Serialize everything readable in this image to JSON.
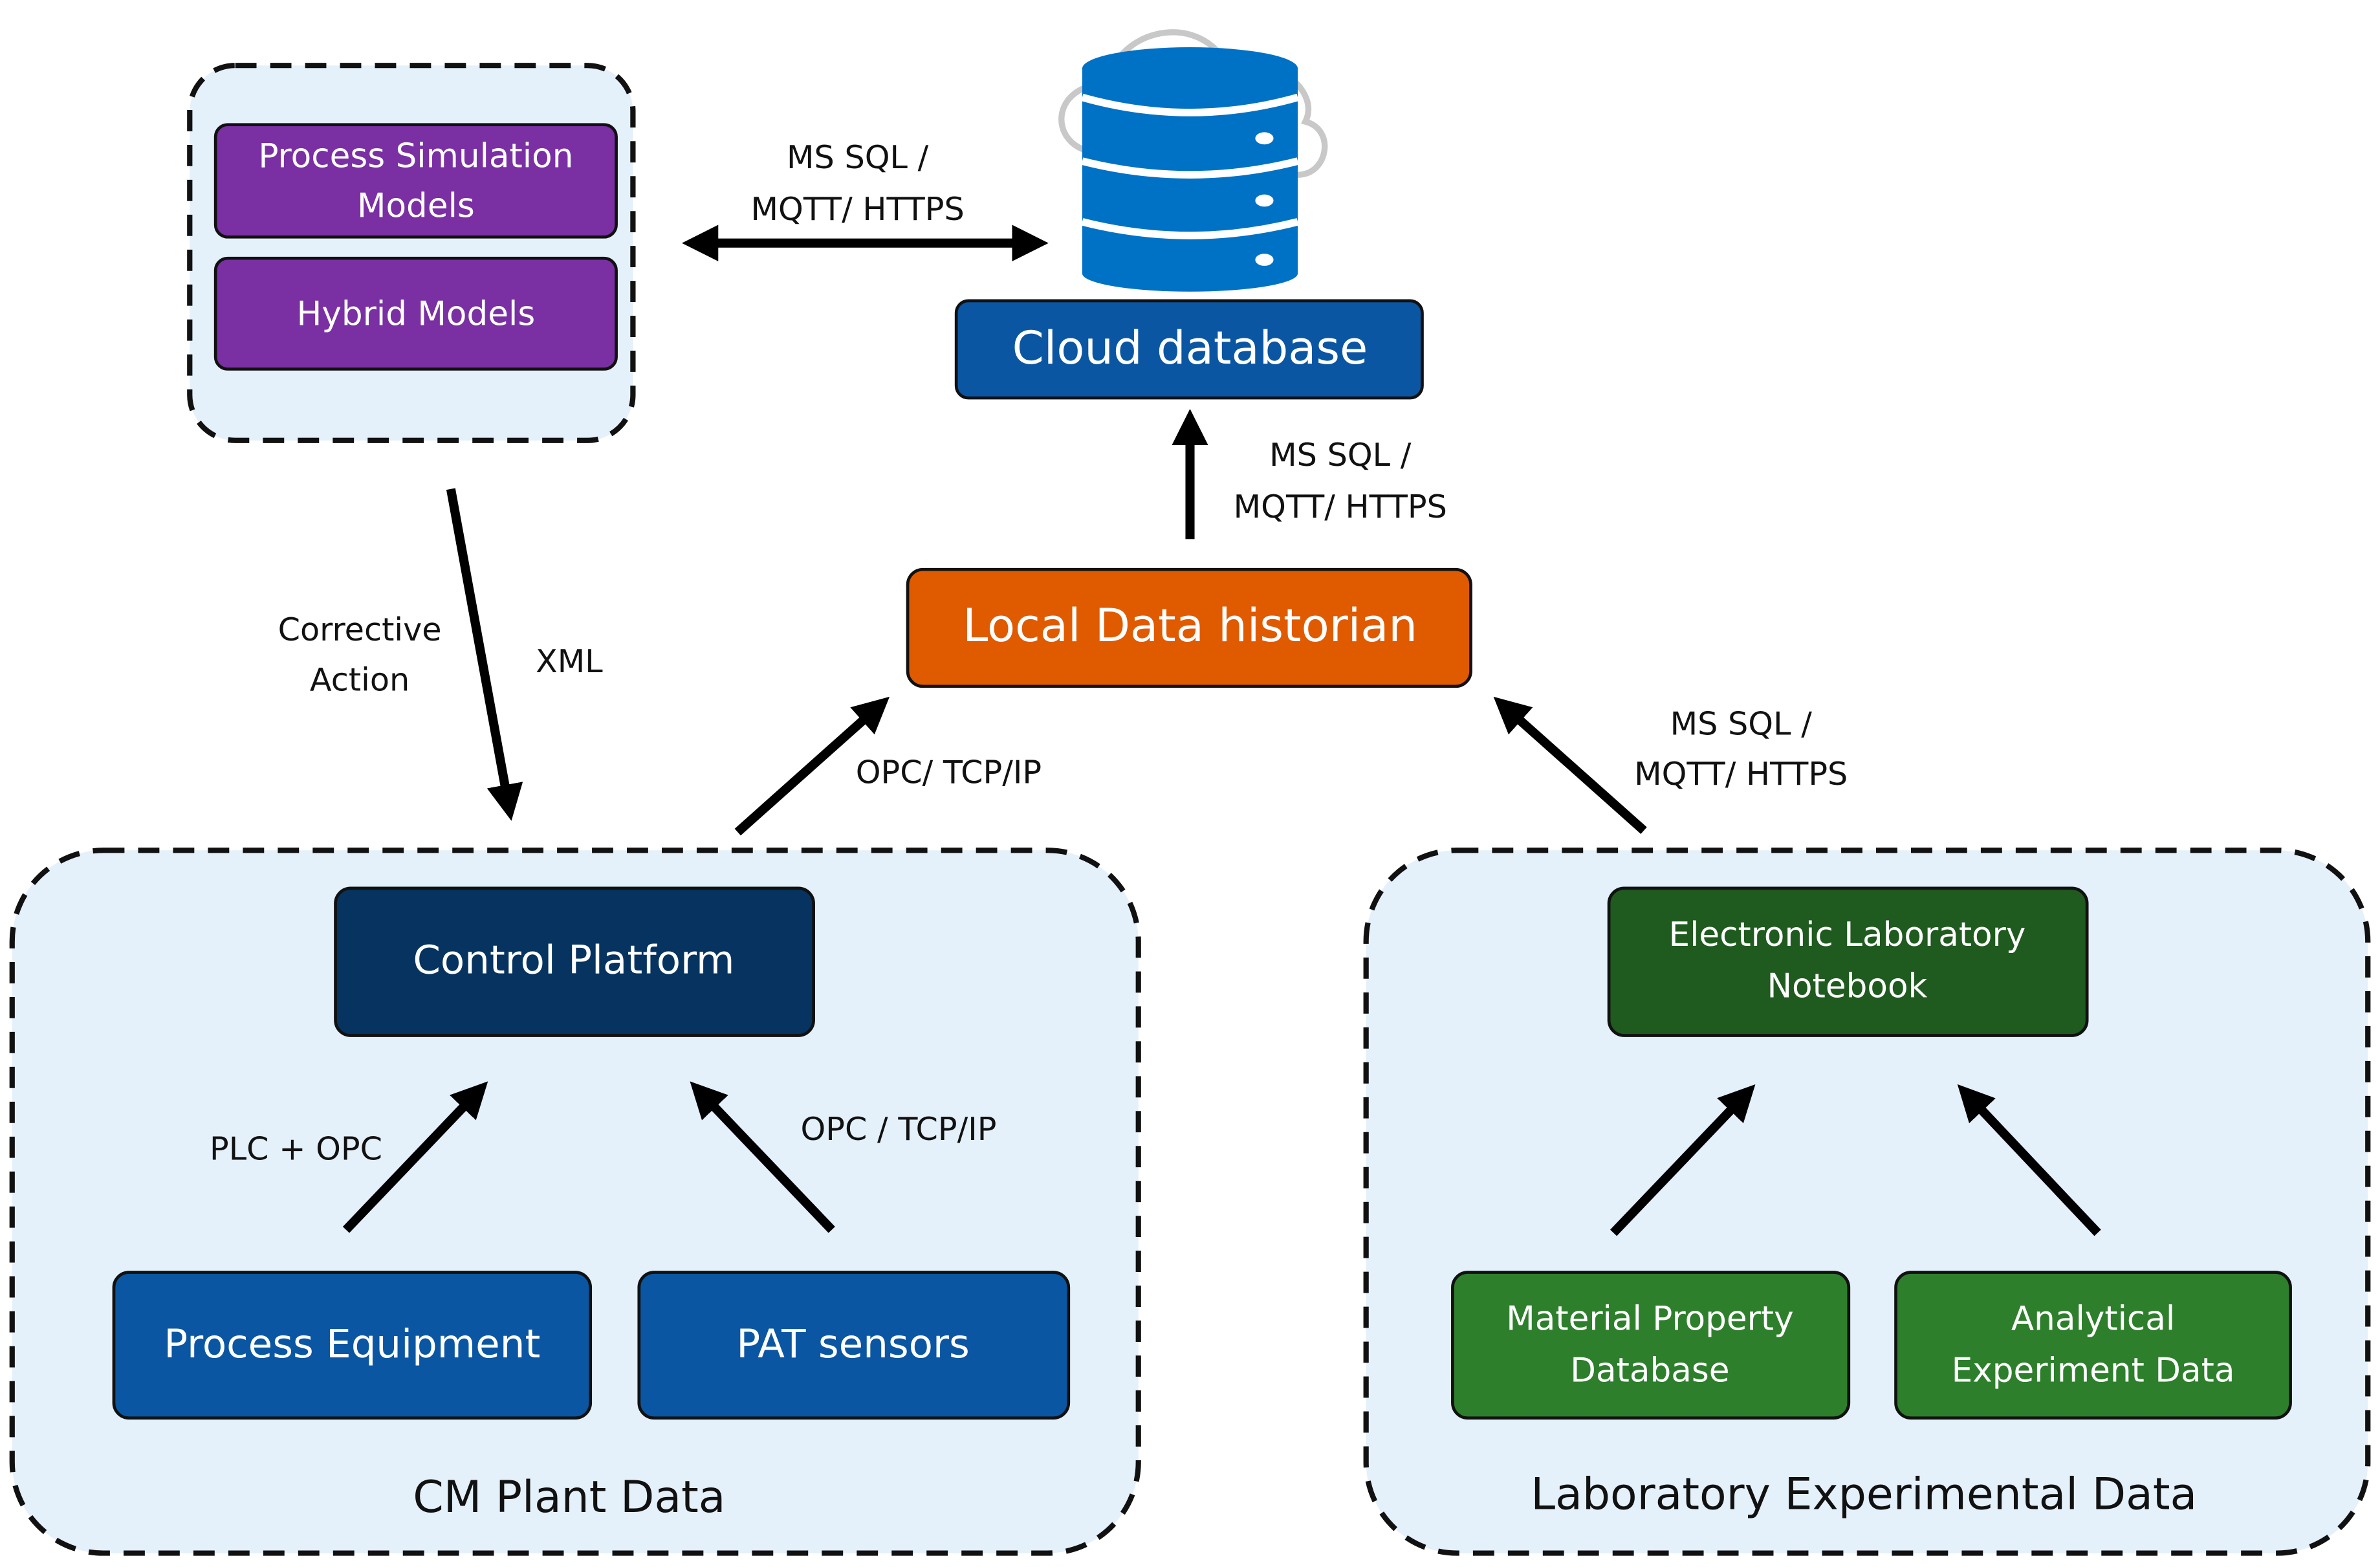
{
  "models": {
    "process_simulation": [
      "Process Simulation",
      "Models"
    ],
    "hybrid": "Hybrid Models"
  },
  "cloud_database": "Cloud database",
  "local_historian": "Local Data historian",
  "links": {
    "models_cloud": [
      "MS SQL /",
      "MQTT/ HTTPS"
    ],
    "historian_cloud": [
      "MS SQL /",
      "MQTT/ HTTPS"
    ],
    "plant_historian": "OPC/ TCP/IP",
    "lab_historian": [
      "MS SQL /",
      "MQTT/ HTTPS"
    ],
    "corrective": [
      "Corrective",
      "Action"
    ],
    "xml": "XML",
    "plc_opc": "PLC + OPC",
    "pat_opc": "OPC / TCP/IP"
  },
  "plant": {
    "title": "CM Plant Data",
    "control_platform": "Control Platform",
    "process_equipment": "Process Equipment",
    "pat_sensors": "PAT sensors"
  },
  "lab": {
    "title": "Laboratory Experimental Data",
    "eln": [
      "Electronic Laboratory",
      "Notebook"
    ],
    "material": [
      "Material Property",
      "Database"
    ],
    "analytical": [
      "Analytical",
      "Experiment Data"
    ]
  },
  "colors": {
    "purple": "#7a2fa3",
    "blue": "#0a56a2",
    "navy": "#06335f",
    "orange": "#e05a00",
    "dark_green": "#1f5a1e",
    "green": "#2e7f2c",
    "group_bg": "#e4f0fa",
    "db_blue": "#0072c6"
  }
}
